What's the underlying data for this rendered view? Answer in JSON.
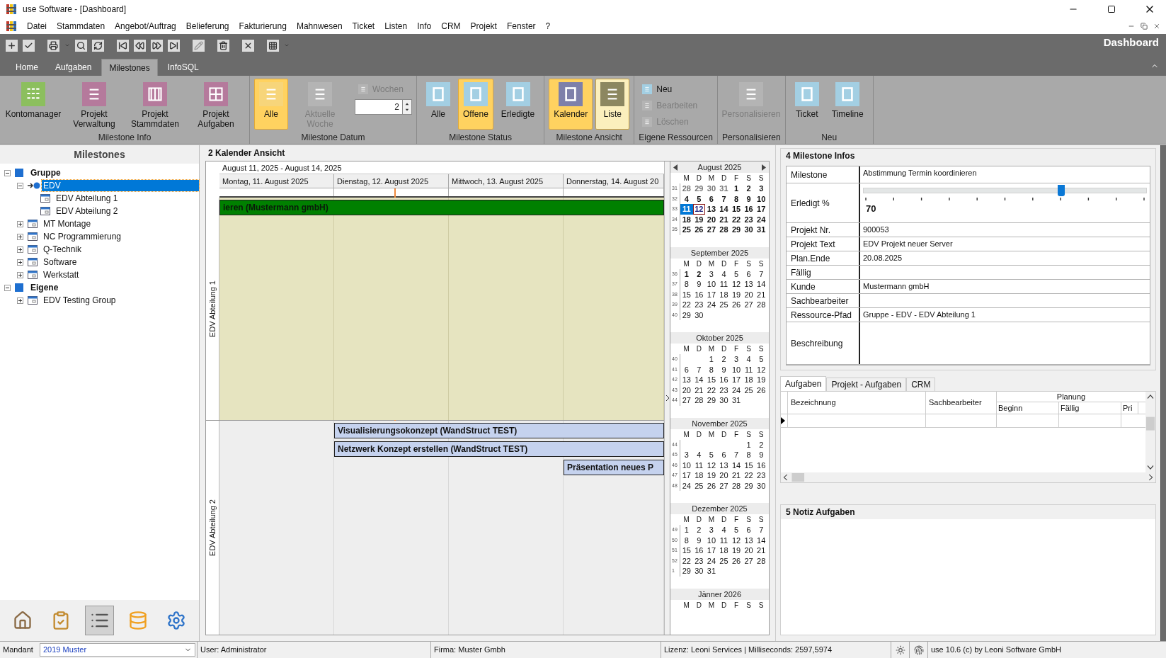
{
  "window": {
    "title": "use Software - [Dashboard]"
  },
  "menu": [
    "Datei",
    "Stammdaten",
    "Angebot/Auftrag",
    "Belieferung",
    "Fakturierung",
    "Mahnwesen",
    "Ticket",
    "Listen",
    "Info",
    "CRM",
    "Projekt",
    "Fenster",
    "?"
  ],
  "toolbar": {
    "title": "Dashboard"
  },
  "ribbon_tabs": [
    {
      "label": "Home",
      "selected": false
    },
    {
      "label": "Aufgaben",
      "selected": false
    },
    {
      "label": "Milestones",
      "selected": true
    },
    {
      "label": "InfoSQL",
      "selected": false
    }
  ],
  "ribbon_groups": [
    {
      "label": "Milestone Info",
      "items": [
        {
          "kind": "large",
          "label": "Kontomanager",
          "pressed": false,
          "hovered": false,
          "disabled": false,
          "color": "#8cbf5e"
        },
        {
          "kind": "large",
          "label": "Projekt Verwaltung",
          "pressed": false,
          "hovered": false,
          "disabled": false,
          "color": "#b57a9c"
        },
        {
          "kind": "large",
          "label": "Projekt Stammdaten",
          "pressed": false,
          "hovered": false,
          "disabled": false,
          "color": "#b57a9c"
        },
        {
          "kind": "large",
          "label": "Projekt Aufgaben",
          "pressed": false,
          "hovered": false,
          "disabled": false,
          "color": "#b57a9c"
        }
      ]
    },
    {
      "label": "Milestone Datum",
      "items": [
        {
          "kind": "large",
          "label": "Alle",
          "pressed": true,
          "hovered": false,
          "disabled": false,
          "color": "#f7d57a"
        },
        {
          "kind": "large",
          "label": "Aktuelle Woche",
          "pressed": false,
          "hovered": false,
          "disabled": true,
          "color": "#b4b4b4"
        },
        {
          "kind": "weeks",
          "label": "Wochen",
          "pressed": false,
          "hovered": false,
          "disabled": true,
          "value": "2"
        }
      ]
    },
    {
      "label": "Milestone Status",
      "items": [
        {
          "kind": "large",
          "label": "Alle",
          "pressed": false,
          "hovered": false,
          "disabled": false,
          "color": "#a3cfe3"
        },
        {
          "kind": "large",
          "label": "Offene",
          "pressed": true,
          "hovered": false,
          "disabled": false,
          "color": "#a3cfe3"
        },
        {
          "kind": "large",
          "label": "Erledigte",
          "pressed": false,
          "hovered": false,
          "disabled": false,
          "color": "#a3cfe3"
        }
      ]
    },
    {
      "label": "Milestone Ansicht",
      "items": [
        {
          "kind": "large",
          "label": "Kalender",
          "pressed": true,
          "hovered": false,
          "disabled": false,
          "color": "#7e80aa"
        },
        {
          "kind": "large",
          "label": "Liste",
          "pressed": false,
          "hovered": true,
          "disabled": false,
          "color": "#8c8760"
        }
      ]
    },
    {
      "label": "Eigene Ressourcen",
      "items": [
        {
          "kind": "small",
          "label": "Neu",
          "pressed": false,
          "hovered": false,
          "disabled": false,
          "color": "#a3cfe3"
        },
        {
          "kind": "small",
          "label": "Bearbeiten",
          "pressed": false,
          "hovered": false,
          "disabled": true,
          "color": "#b4b4b4"
        },
        {
          "kind": "small",
          "label": "Löschen",
          "pressed": false,
          "hovered": false,
          "disabled": true,
          "color": "#b4b4b4"
        }
      ]
    },
    {
      "label": "Personalisieren",
      "items": [
        {
          "kind": "large",
          "label": "Personalisieren",
          "pressed": false,
          "hovered": false,
          "disabled": true,
          "color": "#b4b4b4"
        }
      ]
    },
    {
      "label": "Neu",
      "items": [
        {
          "kind": "large",
          "label": "Ticket",
          "pressed": false,
          "hovered": false,
          "disabled": false,
          "color": "#a3cfe3"
        },
        {
          "kind": "large",
          "label": "Timeline",
          "pressed": false,
          "hovered": false,
          "disabled": false,
          "color": "#a3cfe3"
        }
      ]
    }
  ],
  "sidebar": {
    "title": "Milestones",
    "tree": [
      {
        "label": "Gruppe",
        "kind": "group",
        "selected": false,
        "expanded": true,
        "children": [
          {
            "label": "EDV",
            "kind": "current",
            "selected": true,
            "expanded": true,
            "children": [
              {
                "label": "EDV Abteilung 1",
                "kind": "department",
                "selected": false
              },
              {
                "label": "EDV Abteilung 2",
                "kind": "department",
                "selected": false
              }
            ]
          },
          {
            "label": "MT Montage",
            "kind": "department",
            "selected": false,
            "expanded": false
          },
          {
            "label": "NC Programmierung",
            "kind": "department",
            "selected": false,
            "expanded": false
          },
          {
            "label": "Q-Technik",
            "kind": "department",
            "selected": false,
            "expanded": false
          },
          {
            "label": "Software",
            "kind": "department",
            "selected": false,
            "expanded": false
          },
          {
            "label": "Werkstatt",
            "kind": "department",
            "selected": false,
            "expanded": false
          }
        ]
      },
      {
        "label": "Eigene",
        "kind": "group",
        "selected": false,
        "expanded": true,
        "children": [
          {
            "label": "EDV Testing Group",
            "kind": "department",
            "selected": false,
            "expanded": false
          }
        ]
      }
    ],
    "nav": [
      {
        "selected": false
      },
      {
        "selected": false
      },
      {
        "selected": true
      },
      {
        "selected": false
      },
      {
        "selected": false
      }
    ]
  },
  "calendar": {
    "title": "2 Kalender Ansicht",
    "range": "August 11, 2025 - August 14, 2025",
    "days": [
      "Montag, 11. August 2025",
      "Dienstag, 12. August 2025",
      "Mittwoch, 13. August 2025",
      "Donnerstag, 14. August 20"
    ],
    "resources": [
      {
        "label": "EDV Abteilung 1",
        "highlighted": true,
        "events": [
          {
            "title": "ieren (Mustermann gmbH)",
            "kind": "all-day"
          }
        ]
      },
      {
        "label": "EDV Abteilung 2",
        "highlighted": false,
        "events": [
          {
            "title": "Visualisierungsokonzept (WandStruct TEST)",
            "kind": "timed"
          },
          {
            "title": "Netzwerk Konzept erstellen (WandStruct TEST)",
            "kind": "timed"
          },
          {
            "title": "Präsentation neues P",
            "kind": "timed"
          }
        ]
      }
    ]
  },
  "mini_calendar": {
    "months": [
      {
        "title": "August 2025",
        "weekdays": [
          "M",
          "D",
          "M",
          "D",
          "F",
          "S",
          "S"
        ],
        "weeks": [
          {
            "number": "31",
            "kind": "full",
            "days": [
              {
                "day": "28",
                "kind": "other"
              },
              {
                "day": "29",
                "kind": "other"
              },
              {
                "day": "30",
                "kind": "other"
              },
              {
                "day": "31",
                "kind": "other"
              },
              {
                "day": "1",
                "kind": "bold"
              },
              {
                "day": "2",
                "kind": "bold"
              },
              {
                "day": "3",
                "kind": "bold"
              }
            ]
          },
          {
            "number": "32",
            "kind": "full",
            "days": [
              {
                "day": "4",
                "kind": "bold"
              },
              {
                "day": "5",
                "kind": "bold"
              },
              {
                "day": "6",
                "kind": "bold"
              },
              {
                "day": "7",
                "kind": "bold"
              },
              {
                "day": "8",
                "kind": "bold"
              },
              {
                "day": "9",
                "kind": "bold"
              },
              {
                "day": "10",
                "kind": "bold"
              }
            ]
          },
          {
            "number": "33",
            "kind": "full",
            "days": [
              {
                "day": "11",
                "kind": "selected"
              },
              {
                "day": "12",
                "kind": "today"
              },
              {
                "day": "13",
                "kind": "bold"
              },
              {
                "day": "14",
                "kind": "bold"
              },
              {
                "day": "15",
                "kind": "bold"
              },
              {
                "day": "16",
                "kind": "bold"
              },
              {
                "day": "17",
                "kind": "bold"
              }
            ]
          },
          {
            "number": "34",
            "kind": "full",
            "days": [
              {
                "day": "18",
                "kind": "bold"
              },
              {
                "day": "19",
                "kind": "bold"
              },
              {
                "day": "20",
                "kind": "bold"
              },
              {
                "day": "21",
                "kind": "bold"
              },
              {
                "day": "22",
                "kind": "bold"
              },
              {
                "day": "23",
                "kind": "bold"
              },
              {
                "day": "24",
                "kind": "bold"
              }
            ]
          },
          {
            "number": "35",
            "kind": "full",
            "days": [
              {
                "day": "25",
                "kind": "bold"
              },
              {
                "day": "26",
                "kind": "bold"
              },
              {
                "day": "27",
                "kind": "bold"
              },
              {
                "day": "28",
                "kind": "bold"
              },
              {
                "day": "29",
                "kind": "bold"
              },
              {
                "day": "30",
                "kind": "bold"
              },
              {
                "day": "31",
                "kind": "bold"
              }
            ]
          }
        ]
      },
      {
        "title": "September 2025",
        "weekdays": [
          "M",
          "D",
          "M",
          "D",
          "F",
          "S",
          "S"
        ],
        "weeks": [
          {
            "number": "36",
            "kind": "full",
            "days": [
              {
                "day": "1",
                "kind": "bold"
              },
              {
                "day": "2",
                "kind": "bold"
              },
              "3",
              "4",
              "5",
              "6",
              "7"
            ]
          },
          {
            "number": "37",
            "kind": "full",
            "days": [
              "8",
              "9",
              "10",
              "11",
              "12",
              "13",
              "14"
            ]
          },
          {
            "number": "38",
            "kind": "full",
            "days": [
              "15",
              "16",
              "17",
              "18",
              "19",
              "20",
              "21"
            ]
          },
          {
            "number": "39",
            "kind": "full",
            "days": [
              "22",
              "23",
              "24",
              "25",
              "26",
              "27",
              "28"
            ]
          },
          {
            "number": "40",
            "kind": "trailing",
            "days": [
              "29",
              "30"
            ]
          }
        ]
      },
      {
        "title": "Oktober 2025",
        "weekdays": [
          "M",
          "D",
          "M",
          "D",
          "F",
          "S",
          "S"
        ],
        "weeks": [
          {
            "number": "40",
            "kind": "leading",
            "days": [
              "1",
              "2",
              "3",
              "4",
              "5"
            ]
          },
          {
            "number": "41",
            "kind": "full",
            "days": [
              "6",
              "7",
              "8",
              "9",
              "10",
              "11",
              "12"
            ]
          },
          {
            "number": "42",
            "kind": "full",
            "days": [
              "13",
              "14",
              "15",
              "16",
              "17",
              "18",
              "19"
            ]
          },
          {
            "number": "43",
            "kind": "full",
            "days": [
              "20",
              "21",
              "22",
              "23",
              "24",
              "25",
              "26"
            ]
          },
          {
            "number": "44",
            "kind": "trailing",
            "days": [
              "27",
              "28",
              "29",
              "30",
              "31"
            ]
          }
        ]
      },
      {
        "title": "November 2025",
        "weekdays": [
          "M",
          "D",
          "M",
          "D",
          "F",
          "S",
          "S"
        ],
        "weeks": [
          {
            "number": "44",
            "kind": "leading",
            "days": [
              "1",
              "2"
            ]
          },
          {
            "number": "45",
            "kind": "full",
            "days": [
              "3",
              "4",
              "5",
              "6",
              "7",
              "8",
              "9"
            ]
          },
          {
            "number": "46",
            "kind": "full",
            "days": [
              "10",
              "11",
              "12",
              "13",
              "14",
              "15",
              "16"
            ]
          },
          {
            "number": "47",
            "kind": "full",
            "days": [
              "17",
              "18",
              "19",
              "20",
              "21",
              "22",
              "23"
            ]
          },
          {
            "number": "48",
            "kind": "full",
            "days": [
              "24",
              "25",
              "26",
              "27",
              "28",
              "29",
              "30"
            ]
          }
        ]
      },
      {
        "title": "Dezember 2025",
        "weekdays": [
          "M",
          "D",
          "M",
          "D",
          "F",
          "S",
          "S"
        ],
        "weeks": [
          {
            "number": "49",
            "kind": "full",
            "days": [
              "1",
              "2",
              "3",
              "4",
              "5",
              "6",
              "7"
            ]
          },
          {
            "number": "50",
            "kind": "full",
            "days": [
              "8",
              "9",
              "10",
              "11",
              "12",
              "13",
              "14"
            ]
          },
          {
            "number": "51",
            "kind": "full",
            "days": [
              "15",
              "16",
              "17",
              "18",
              "19",
              "20",
              "21"
            ]
          },
          {
            "number": "52",
            "kind": "full",
            "days": [
              "22",
              "23",
              "24",
              "25",
              "26",
              "27",
              "28"
            ]
          },
          {
            "number": "1",
            "kind": "trailing",
            "days": [
              "29",
              "30",
              "31"
            ]
          }
        ]
      },
      {
        "title": "Jänner 2026",
        "weekdays": [
          "M",
          "D",
          "M",
          "D",
          "F",
          "S",
          "S"
        ]
      }
    ]
  },
  "milestone_info": {
    "title": "4 Milestone Infos",
    "rows": [
      {
        "label": "Milestone",
        "kind": "text",
        "value": "Abstimmung Termin koordinieren"
      },
      {
        "label": "Erledigt %",
        "kind": "slider",
        "level": 0.7,
        "reading": "70"
      },
      {
        "label": "Projekt Nr.",
        "kind": "text",
        "value": "900053"
      },
      {
        "label": "Projekt Text",
        "kind": "text",
        "value": "EDV Projekt neuer Server"
      },
      {
        "label": "Plan.Ende",
        "kind": "text",
        "value": "20.08.2025"
      },
      {
        "label": "Fällig",
        "kind": "text"
      },
      {
        "label": "Kunde",
        "kind": "text",
        "value": "Mustermann gmbH"
      },
      {
        "label": "Sachbearbeiter",
        "kind": "text"
      },
      {
        "label": "Ressource-Pfad",
        "kind": "text",
        "value": "Gruppe - EDV - EDV Abteilung 1"
      },
      {
        "label": "Beschreibung",
        "kind": "memo"
      }
    ]
  },
  "task_tabs": [
    {
      "label": "Aufgaben",
      "selected": true
    },
    {
      "label": "Projekt - Aufgaben",
      "selected": false
    },
    {
      "label": "CRM",
      "selected": false
    }
  ],
  "task_table": {
    "columns": [
      {
        "label": "Bezeichnung"
      },
      {
        "label": "Sachbearbeiter"
      },
      {
        "label": "Planung",
        "children": [
          "Beginn",
          "Fällig",
          "Pri"
        ]
      }
    ],
    "rows": [
      {
        "current": true
      }
    ]
  },
  "notes": {
    "title": "5 Notiz Aufgaben"
  },
  "status_bar": {
    "mandant_label": "Mandant",
    "mandant": "2019 Muster",
    "user": "User: Administrator",
    "firma": "Firma: Muster Gmbh",
    "lizenz": "Lizenz: Leoni Services | Milliseconds: 2597,5974",
    "version": "use 10.6 (c) by Leoni Software GmbH"
  }
}
